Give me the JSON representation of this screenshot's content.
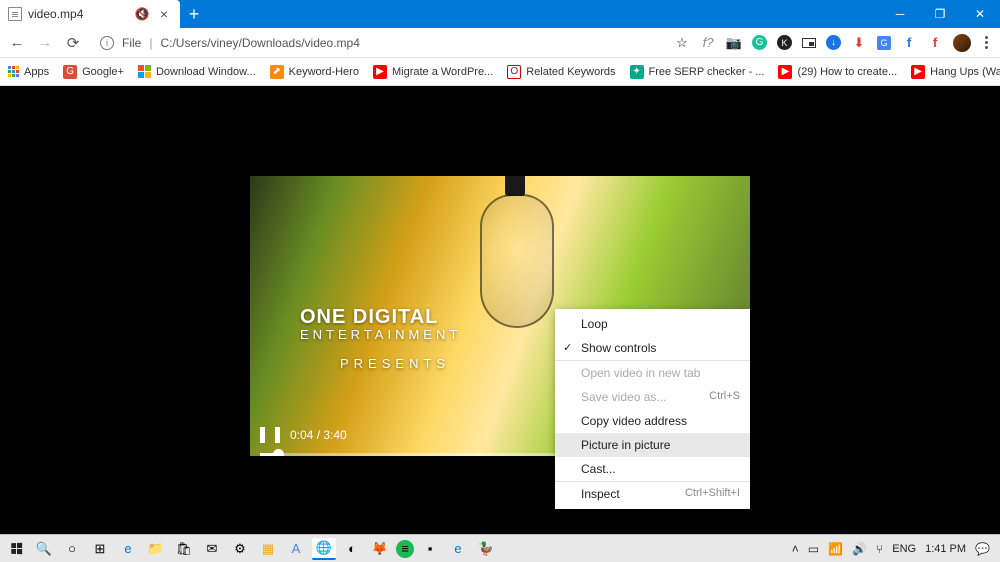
{
  "tab": {
    "title": "video.mp4"
  },
  "url": {
    "prefix": "File",
    "path": "C:/Users/viney/Downloads/video.mp4"
  },
  "bookmarks": [
    {
      "label": "Apps",
      "icon": "apps"
    },
    {
      "label": "Google+",
      "icon": "G",
      "bg": "#dd4b39"
    },
    {
      "label": "Download Window...",
      "icon": "ms"
    },
    {
      "label": "Keyword-Hero",
      "icon": "⬈",
      "bg": "#ff8c00"
    },
    {
      "label": "Migrate a WordPre...",
      "icon": "▶",
      "bg": "#ff0000"
    },
    {
      "label": "Related Keywords",
      "icon": "O",
      "bg": "#fff",
      "fg": "#c00",
      "bd": "#c00"
    },
    {
      "label": "Free SERP checker - ...",
      "icon": "✦",
      "bg": "#0a8"
    },
    {
      "label": "(29) How to create...",
      "icon": "▶",
      "bg": "#ff0000"
    },
    {
      "label": "Hang Ups (Want Yo...",
      "icon": "▶",
      "bg": "#ff0000"
    }
  ],
  "video": {
    "overlay": {
      "line1": "ONE DIGITAL",
      "line2": "ENTERTAINMENT",
      "line3": "PRESENTS"
    },
    "current": "0:04",
    "duration": "3:40"
  },
  "context_menu": [
    {
      "label": "Loop"
    },
    {
      "label": "Show controls",
      "checked": true
    },
    {
      "label": "Open video in new tab",
      "disabled": true,
      "sep": true
    },
    {
      "label": "Save video as...",
      "shortcut": "Ctrl+S",
      "disabled": true
    },
    {
      "label": "Copy video address"
    },
    {
      "label": "Picture in picture",
      "highlight": true
    },
    {
      "label": "Cast..."
    },
    {
      "label": "Inspect",
      "shortcut": "Ctrl+Shift+I",
      "sep": true
    }
  ],
  "tray": {
    "lang": "ENG",
    "time": "1:41 PM"
  }
}
